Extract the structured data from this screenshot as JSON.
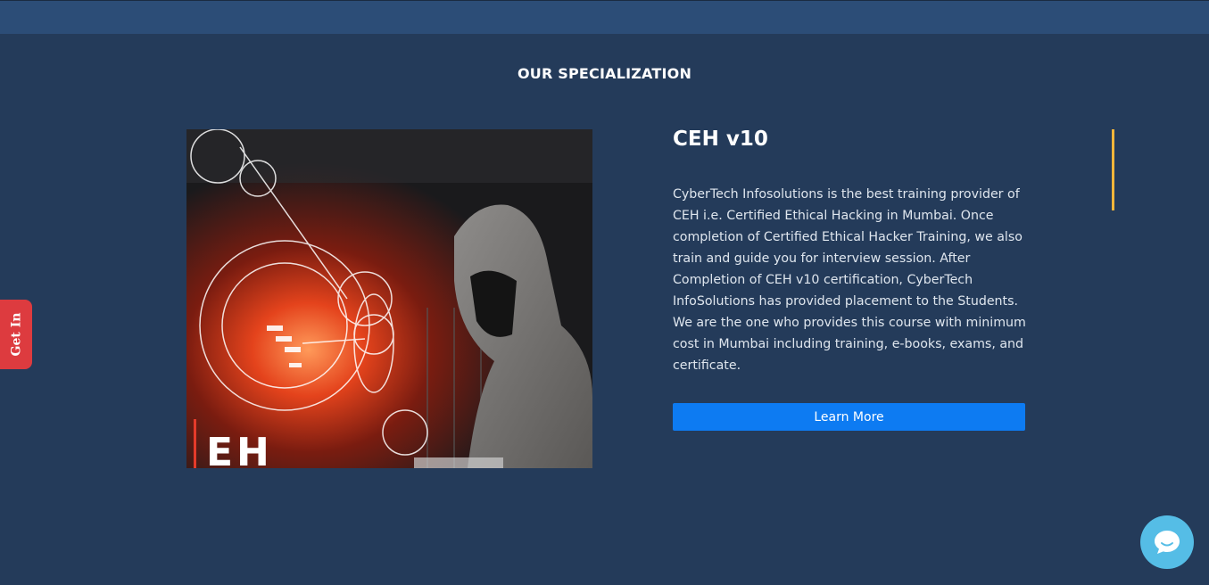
{
  "section": {
    "title": "OUR SPECIALIZATION"
  },
  "course": {
    "title": "CEH v10",
    "description": "CyberTech Infosolutions is the best training provider of CEH i.e. Certified Ethical Hacking in Mumbai. Once completion of Certified Ethical Hacker Training, we also train and guide you for interview session. After Completion of CEH v10 certification, CyberTech InfoSolutions has provided placement to the Students. We are the one who provides this course with minimum cost in Mumbai including training, e-books, exams, and certificate.",
    "button_label": "Learn More",
    "image_text": "EH"
  },
  "side_tab": {
    "label": "Get In"
  },
  "icons": {
    "chat": "chat-bubble-icon"
  },
  "colors": {
    "background": "#243b5a",
    "topbar": "#2c4d77",
    "button": "#0d7bf2",
    "accent": "#f3b63a",
    "side_tab": "#dd3b3f",
    "chat": "#55bde6"
  }
}
